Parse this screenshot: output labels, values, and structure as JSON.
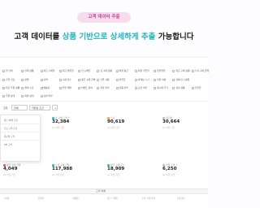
{
  "hero": {
    "badge": "고객 데이터 추출",
    "title_part1": "고객 데이터를 ",
    "title_highlight": "상품 기반으로 상세하게 추출",
    "title_part2": " 가능합니다",
    "highlight_color": "#22b4bf",
    "badge_color": "#d0409a"
  },
  "filters": {
    "row1": [
      "행 선택",
      "전체 상품",
      "최근 구매일",
      "최근 방문일",
      "첫 구매일",
      "첫 구매 상품",
      "회원 등급",
      "회원 가입일",
      "생년월일",
      "최근 구매 상품",
      "누적 구매 금액"
    ],
    "row2": [
      "가입 경로",
      "성별",
      "지역",
      "구매 횟수",
      "평균 구매 금액",
      "쿠폰 사용",
      "적립금",
      "마케팅 수신",
      "리뷰 작성",
      "장바구니 상품"
    ],
    "row3": [
      "최근 주문 상품",
      "결제 수단",
      "배송지",
      "유입 채널",
      "이벤트 참여",
      "환불 여부",
      "반품 여부",
      "교환 여부",
      "재구매 주기",
      "관심 상품",
      "추천인"
    ],
    "row4": [
      "주문 상태",
      "회원 상태",
      "휴면 여부"
    ]
  },
  "toolbar": {
    "label": "조회",
    "dropdown1": "전체",
    "dropdown2": "저장된 조건",
    "action": "+"
  },
  "dropdown": {
    "items": [
      "최근 90일 조건",
      "신규 고객 조건",
      "재구매 고객",
      "VIP 고객"
    ]
  },
  "kpis": [
    {
      "label": "총 구매 고객 수",
      "value": "32,384",
      "sub": "vs. 이전 기간",
      "color": "#22b4bf"
    },
    {
      "label": "신규",
      "value": "90,619",
      "sub": "vs. 이전 기간",
      "color": "#f5a623"
    },
    {
      "label": "재구매",
      "value": "30,664",
      "sub": "vs. 이전 기간",
      "color": "#bbbbbb"
    },
    {
      "label": "평균 구매 금액",
      "value": "4,049",
      "sub": "vs. 이전 기간",
      "color": "#d0409a"
    },
    {
      "label": "누적 구매 금액",
      "value": "117,988",
      "sub": "vs. 이전 기간",
      "color": "#22b4bf"
    },
    {
      "label": "평균 구매 횟수",
      "value": "18,909",
      "sub": "vs. 이전 기간",
      "color": "#22b4bf"
    },
    {
      "label": "이탈 고객 수",
      "value": "6,250",
      "sub": "vs. 이전 기간",
      "color": "#bbbbbb"
    }
  ],
  "table": {
    "title": "고객 목록",
    "columns": [
      "고객명",
      "연락처",
      "이메일",
      "최근 구매일",
      "누적 구매 금액",
      "구매 횟수"
    ]
  }
}
